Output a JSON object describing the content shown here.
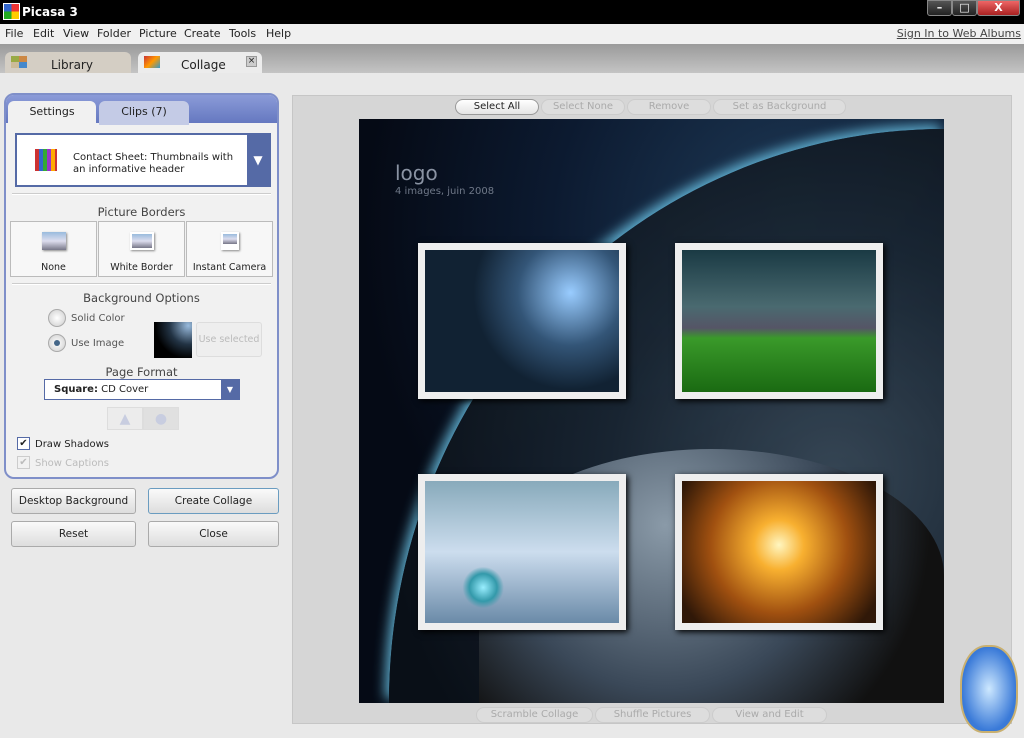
{
  "window": {
    "title": "Picasa 3",
    "minimize": "–",
    "maximize": "□",
    "close": "X"
  },
  "menu": [
    "File",
    "Edit",
    "View",
    "Folder",
    "Picture",
    "Create",
    "Tools",
    "Help"
  ],
  "sign_in": "Sign In to Web Albums",
  "tabs": [
    {
      "label": "Library"
    },
    {
      "label": "Collage",
      "close": "×"
    }
  ],
  "panel": {
    "tabs": [
      "Settings",
      "Clips (7)"
    ],
    "collage_type": "Contact Sheet:  Thumbnails with an informative header",
    "picture_borders": {
      "title": "Picture Borders",
      "options": [
        "None",
        "White Border",
        "Instant Camera"
      ]
    },
    "background": {
      "title": "Background Options",
      "solid": "Solid Color",
      "image": "Use Image",
      "use_selected": "Use selected",
      "selected": "Use Image"
    },
    "page_format": {
      "title": "Page Format",
      "bold": "Square:",
      "value": "CD Cover"
    },
    "draw_shadows": {
      "label": "Draw Shadows",
      "checked": true
    },
    "show_captions": {
      "label": "Show Captions",
      "checked": true,
      "disabled": true
    }
  },
  "actions": [
    "Desktop Background",
    "Create Collage",
    "Reset",
    "Close"
  ],
  "toolbar_top": [
    "Select All",
    "Select None",
    "Remove",
    "Set as Background"
  ],
  "toolbar_bottom": [
    "Scramble Collage",
    "Shuffle Pictures",
    "View and Edit"
  ],
  "collage": {
    "title": "logo",
    "subtitle": "4 images, juin 2008"
  },
  "colors": {
    "accent": "#6578c0",
    "titlebar": "#000000",
    "close": "#c0392b"
  }
}
